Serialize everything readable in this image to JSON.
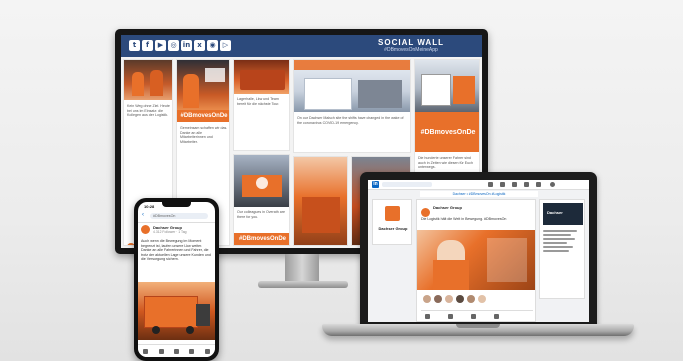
{
  "social_wall": {
    "title": "SOCIAL WALL",
    "subtitle": "#DBmovesOnMeineApp",
    "social_icons": [
      "twitter-icon",
      "facebook-icon",
      "youtube-icon",
      "instagram-icon",
      "linkedin-icon",
      "xing-icon",
      "camera-icon",
      "podcast-icon"
    ],
    "icon_glyphs": [
      "t",
      "f",
      "▶",
      "◎",
      "in",
      "x",
      "◉",
      "▷"
    ],
    "hashtag_label": "#DBmovesOnDe",
    "card_texts": [
      "Kein Weg ohne Ziel. Heute bei uns im Einsatz: die Kollegen aus der Logistik.",
      "Gemeinsam schaffen wir das. Danke an alle Mitarbeiterinnen und Mitarbeiter.",
      "Lagerhalle, Lkw und Team bereit für die nächste Tour.",
      "On our Dachser Malsch site the shifts have changed in the wake of the coronavirus COVID-19 emergency.",
      "Die hunderte unserer Fahrer sind auch in Zeiten wie diesen für Euch unterwegs.",
      "Our colleagues in Overath are there for you."
    ]
  },
  "laptop": {
    "linkedin_logo": "in",
    "banner_text": "Dachser • #DBmovesOn #Logistik",
    "company_name": "Dachser Group",
    "post_text": "Die Logistik hält die Welt in Bewegung. #DBmovesOn",
    "sidebar_title": "Dachser"
  },
  "phone": {
    "time": "10:28",
    "search_placeholder": "#DBmovesOn",
    "author": "Dachser Group",
    "meta": "4.312 Follower · 1 Tag",
    "post_text": "Auch wenn die Bewegung im Moment begrenzt ist, laufen unsere Lkw weiter. Danke an alle Fahrerinnen und Fahrer, die trotz der aktuellen Lage unsere Kunden und die Versorgung sichern."
  },
  "colors": {
    "accent": "#e8702a",
    "header": "#2c4a7c",
    "linkedin": "#0a66c2"
  }
}
